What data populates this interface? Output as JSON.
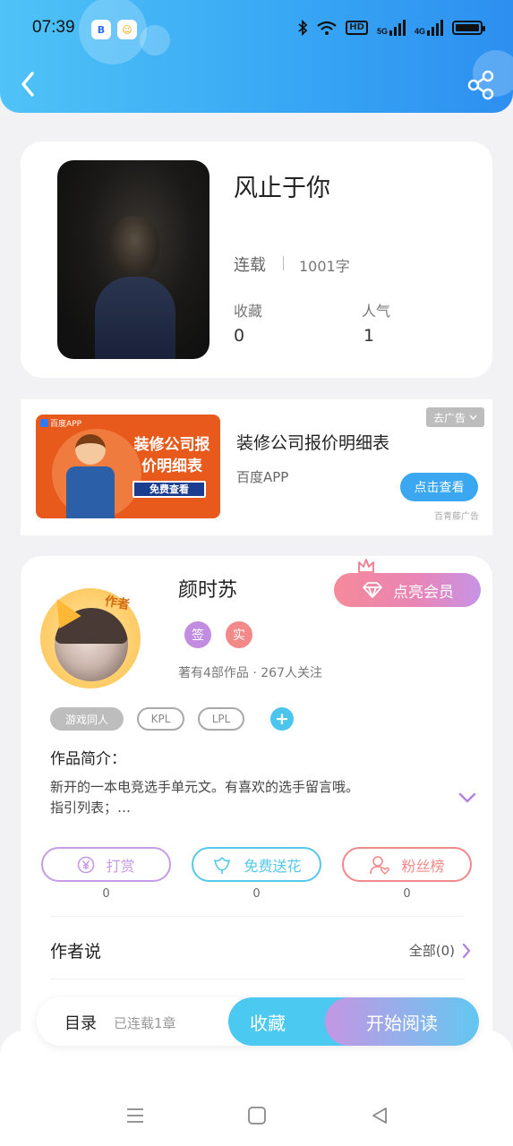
{
  "status_bar": {
    "time": "07:39",
    "indicators": [
      "bluetooth-icon",
      "wifi-icon",
      "hd-icon",
      "5g-signal-icon",
      "4g-signal-icon",
      "battery-icon"
    ],
    "hd_label": "HD",
    "net1": "5G",
    "net2": "4G"
  },
  "header": {
    "background": "#38a8f4"
  },
  "book": {
    "title": "风止于你",
    "status": "连载",
    "words": "1001字",
    "collect_label": "收藏",
    "collect_value": "0",
    "popularity_label": "人气",
    "popularity_value": "1"
  },
  "ad": {
    "image_badge": "百度APP",
    "image_title": "装修公司报价明细表",
    "image_button": "免费查看",
    "title": "装修公司报价明细表",
    "source": "百度APP",
    "tag": "去广告",
    "button": "点击查看",
    "mark": "百青藤广告"
  },
  "author": {
    "avatar_tag": "作者",
    "name": "颜时苏",
    "vip_button": "点亮会员",
    "badges": [
      {
        "label": "签",
        "color": "#c28de0"
      },
      {
        "label": "实",
        "color": "#f28888"
      }
    ],
    "meta": "著有4部作品 · 267人关注",
    "tags": [
      "游戏同人",
      "KPL",
      "LPL"
    ],
    "intro_title": "作品简介：",
    "intro_line1": "新开的一本电竞选手单元文。有喜欢的选手留言哦。",
    "intro_line2": "指引列表；…",
    "actions": [
      {
        "label": "打赏",
        "count": "0",
        "color": "#c79be6"
      },
      {
        "label": "免费送花",
        "count": "0",
        "color": "#55c8ea"
      },
      {
        "label": "粉丝榜",
        "count": "0",
        "color": "#f08a8a"
      }
    ],
    "say_title": "作者说",
    "say_all": "全部(0)"
  },
  "bottom_bar": {
    "toc": "目录",
    "toc_sub": "已连载1章",
    "collect": "收藏",
    "read": "开始阅读"
  },
  "nav": {
    "buttons": [
      "menu-icon",
      "home-square-icon",
      "back-triangle-icon"
    ]
  }
}
